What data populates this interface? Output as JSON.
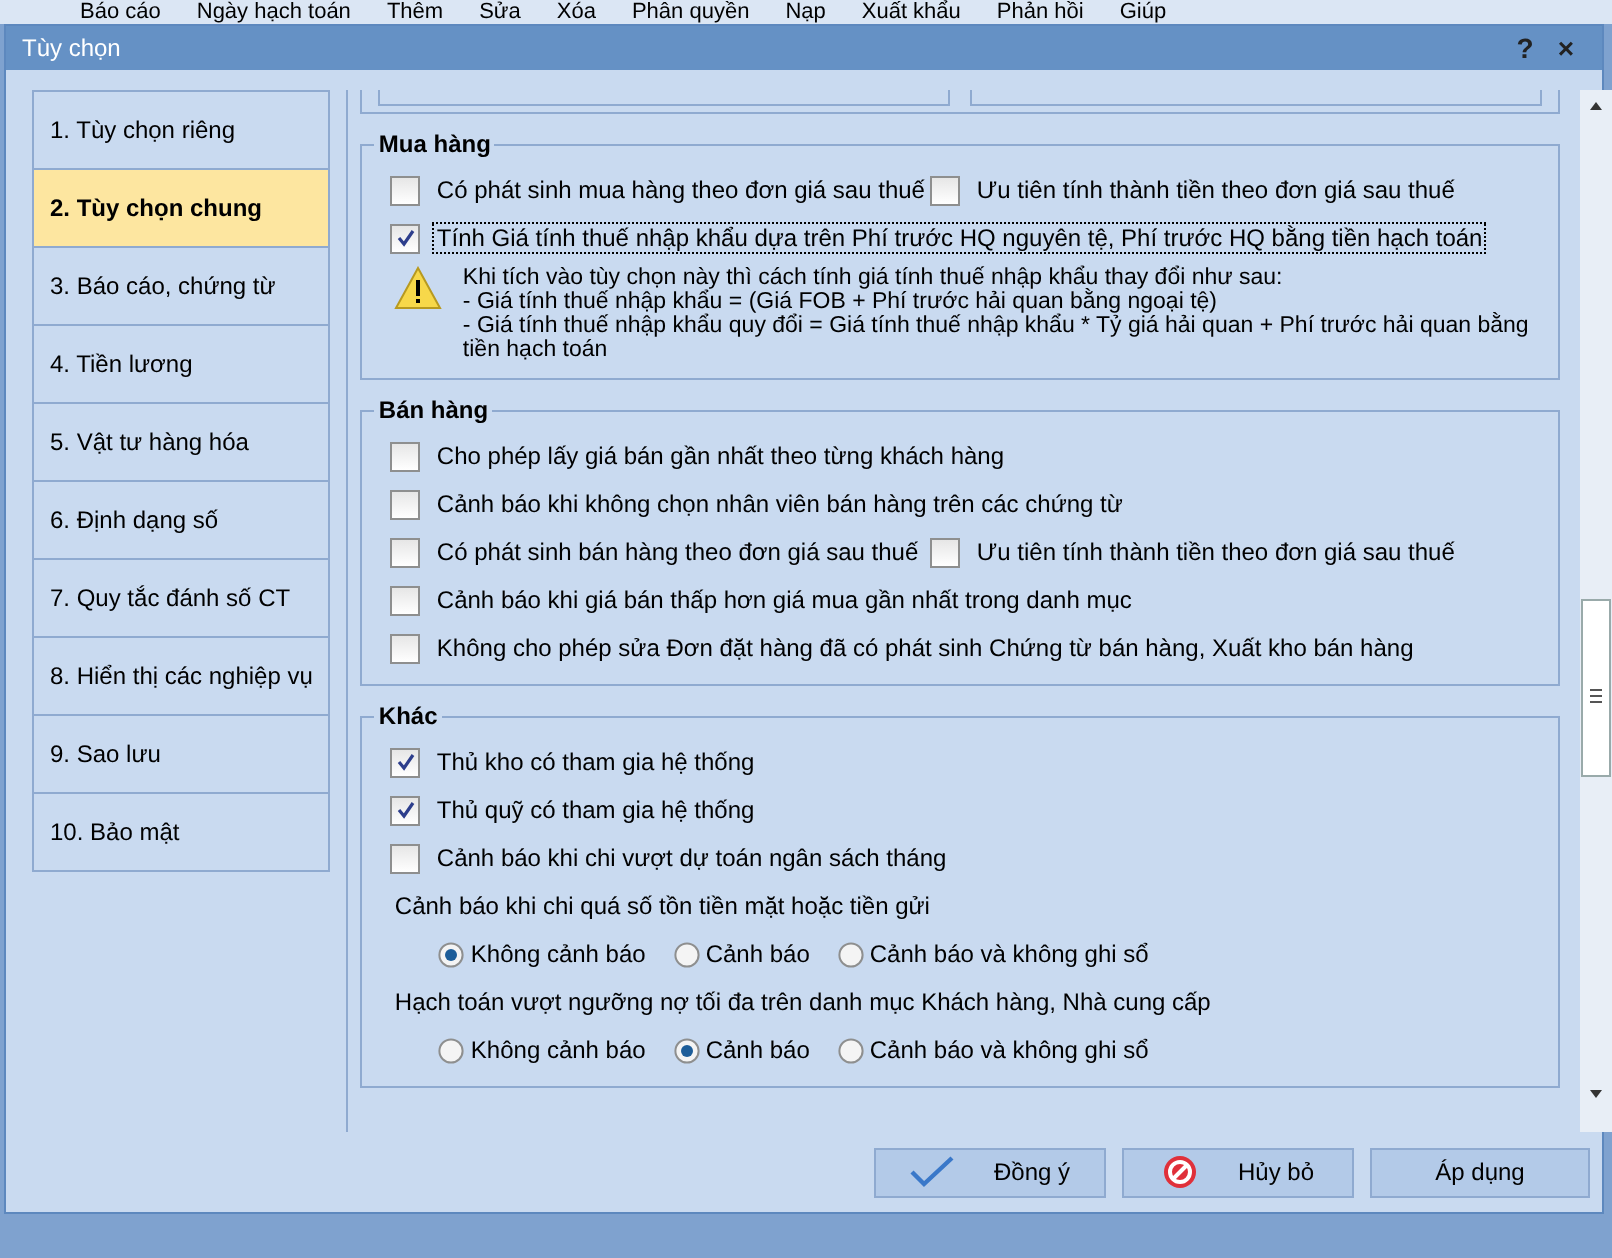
{
  "toolbar": [
    {
      "label": "Báo cáo"
    },
    {
      "label": "Ngày hạch toán"
    },
    {
      "label": "Thêm"
    },
    {
      "label": "Sửa"
    },
    {
      "label": "Xóa"
    },
    {
      "label": "Phân quyền"
    },
    {
      "label": "Nạp"
    },
    {
      "label": "Xuất khẩu"
    },
    {
      "label": "Phản hồi"
    },
    {
      "label": "Giúp"
    }
  ],
  "dialog": {
    "title": "Tùy chọn",
    "help": "?",
    "close": "×"
  },
  "nav": [
    {
      "label": "1. Tùy chọn riêng",
      "selected": false
    },
    {
      "label": "2. Tùy chọn chung",
      "selected": true
    },
    {
      "label": "3. Báo cáo, chứng từ",
      "selected": false
    },
    {
      "label": "4. Tiền lương",
      "selected": false
    },
    {
      "label": "5. Vật tư hàng hóa",
      "selected": false
    },
    {
      "label": "6. Định dạng số",
      "selected": false
    },
    {
      "label": "7. Quy tắc đánh số CT",
      "selected": false
    },
    {
      "label": "8. Hiển thị các nghiệp vụ",
      "selected": false
    },
    {
      "label": "9. Sao lưu",
      "selected": false
    },
    {
      "label": "10. Bảo mật",
      "selected": false
    }
  ],
  "sections": [
    {
      "title": "Mua hàng",
      "rows": [
        {
          "kind": "checks",
          "items": [
            {
              "label": "Có phát sinh mua hàng theo đơn giá sau thuế",
              "checked": false,
              "focused": false
            },
            {
              "label": "Ưu tiên tính thành tiền theo đơn giá sau thuế",
              "checked": false,
              "focused": false
            }
          ]
        },
        {
          "kind": "checks",
          "items": [
            {
              "label": "Tính Giá tính thuế nhập khẩu dựa trên Phí trước HQ nguyên tệ, Phí trước HQ bằng tiền hạch toán",
              "checked": true,
              "focused": true
            }
          ]
        },
        {
          "kind": "warning",
          "lines": [
            "Khi tích vào tùy chọn này thì cách tính giá tính thuế nhập khẩu thay đổi như sau:",
            "- Giá tính thuế nhập khẩu = (Giá FOB + Phí trước hải quan bằng ngoại tệ)",
            "- Giá tính thuế nhập khẩu quy đổi = Giá tính thuế nhập khẩu * Tỷ giá hải quan + Phí trước hải quan bằng tiền hạch toán"
          ]
        }
      ]
    },
    {
      "title": "Bán hàng",
      "rows": [
        {
          "kind": "checks",
          "items": [
            {
              "label": "Cho phép lấy giá bán gần nhất theo từng khách hàng",
              "checked": false,
              "focused": false
            }
          ]
        },
        {
          "kind": "checks",
          "items": [
            {
              "label": "Cảnh báo khi không chọn nhân viên bán hàng trên các chứng từ",
              "checked": false,
              "focused": false
            }
          ]
        },
        {
          "kind": "checks",
          "items": [
            {
              "label": "Có phát sinh bán hàng theo đơn giá sau thuế",
              "checked": false,
              "focused": false
            },
            {
              "label": "Ưu tiên tính thành tiền theo đơn giá sau thuế",
              "checked": false,
              "focused": false
            }
          ]
        },
        {
          "kind": "checks",
          "items": [
            {
              "label": "Cảnh báo khi giá bán thấp hơn giá mua gần nhất trong danh mục",
              "checked": false,
              "focused": false
            }
          ]
        },
        {
          "kind": "checks",
          "items": [
            {
              "label": "Không cho phép sửa Đơn đặt hàng đã có phát sinh Chứng từ bán hàng, Xuất kho bán hàng",
              "checked": false,
              "focused": false
            }
          ]
        }
      ]
    },
    {
      "title": "Khác",
      "rows": [
        {
          "kind": "checks",
          "items": [
            {
              "label": "Thủ kho có tham gia hệ thống",
              "checked": true,
              "focused": false
            }
          ]
        },
        {
          "kind": "checks",
          "items": [
            {
              "label": "Thủ quỹ có tham gia hệ thống",
              "checked": true,
              "focused": false
            }
          ]
        },
        {
          "kind": "checks",
          "items": [
            {
              "label": "Cảnh báo khi chi vượt dự toán ngân sách tháng",
              "checked": false,
              "focused": false
            }
          ]
        },
        {
          "kind": "prompt",
          "text": "Cảnh báo khi chi quá số tồn tiền mặt hoặc tiền gửi"
        },
        {
          "kind": "radios",
          "items": [
            {
              "label": "Không cảnh báo",
              "selected": true
            },
            {
              "label": "Cảnh báo",
              "selected": false
            },
            {
              "label": "Cảnh báo và không ghi sổ",
              "selected": false
            }
          ]
        },
        {
          "kind": "prompt",
          "text": "Hạch toán vượt ngưỡng nợ tối đa trên danh mục Khách hàng, Nhà cung cấp"
        },
        {
          "kind": "radios",
          "items": [
            {
              "label": "Không cảnh báo",
              "selected": false
            },
            {
              "label": "Cảnh báo",
              "selected": true
            },
            {
              "label": "Cảnh báo và không ghi sổ",
              "selected": false
            }
          ]
        }
      ]
    }
  ],
  "buttons": [
    {
      "label": "Đồng ý",
      "kind": "ok"
    },
    {
      "label": "Hủy bỏ",
      "kind": "cancel"
    },
    {
      "label": "Áp dụng",
      "kind": "plain"
    }
  ]
}
